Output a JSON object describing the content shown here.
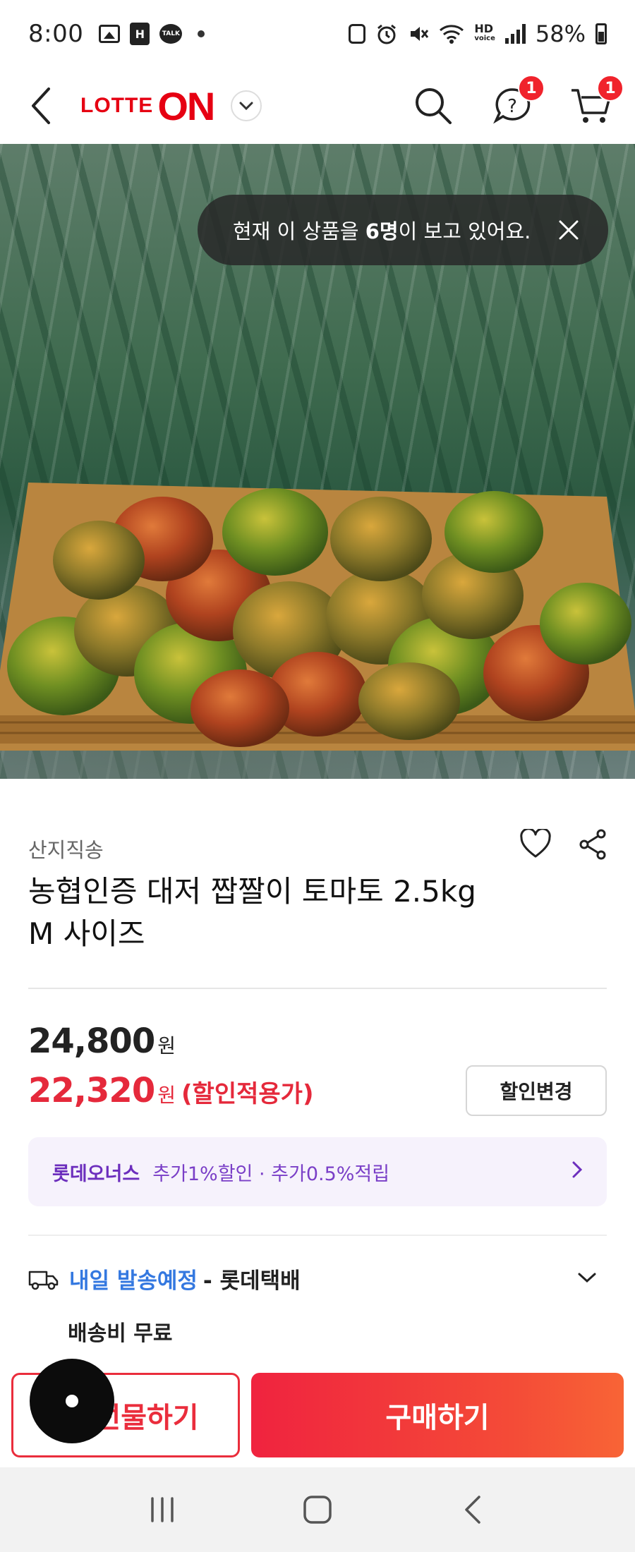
{
  "status_bar": {
    "time": "8:00",
    "h_badge": "H",
    "talk_badge": "TALK",
    "network": "HD",
    "network_sub": "voice",
    "battery": "58%"
  },
  "top_nav": {
    "logo_text_1": "LOTTE",
    "logo_text_2": "ON",
    "brand_color": "#e60012",
    "qna_badge": "1",
    "cart_badge": "1"
  },
  "hero": {
    "toast_prefix": "현재 이 상품을 ",
    "toast_count": "6명",
    "toast_suffix": "이 보고 있어요.",
    "slide_count": 5,
    "active_slide": 1
  },
  "product": {
    "seller": "산지직송",
    "title": "농협인증 대저 짭짤이 토마토 2.5kg M 사이즈",
    "price_original": "24,800",
    "price_original_unit": "원",
    "price_sale": "22,320",
    "price_sale_unit": "원",
    "price_sale_note": "(할인적용가)",
    "discount_button": "할인변경",
    "sale_color": "#e5293b"
  },
  "membership": {
    "name": "롯데오너스",
    "benefit": "추가1%할인 · 추가0.5%적립",
    "color": "#6c2ebd"
  },
  "shipping": {
    "when": "내일 발송예정",
    "carrier": " - 롯데택배",
    "fee": "배송비 무료",
    "when_color": "#3478e0"
  },
  "actions": {
    "gift": "선물하기",
    "buy": "구매하기"
  },
  "icons": {
    "back": "chevron-left-icon",
    "dropdown": "chevron-down-icon",
    "search": "search-icon",
    "qna": "question-chat-icon",
    "cart": "cart-icon",
    "wishlist": "heart-icon",
    "share": "share-icon",
    "truck": "truck-icon"
  }
}
